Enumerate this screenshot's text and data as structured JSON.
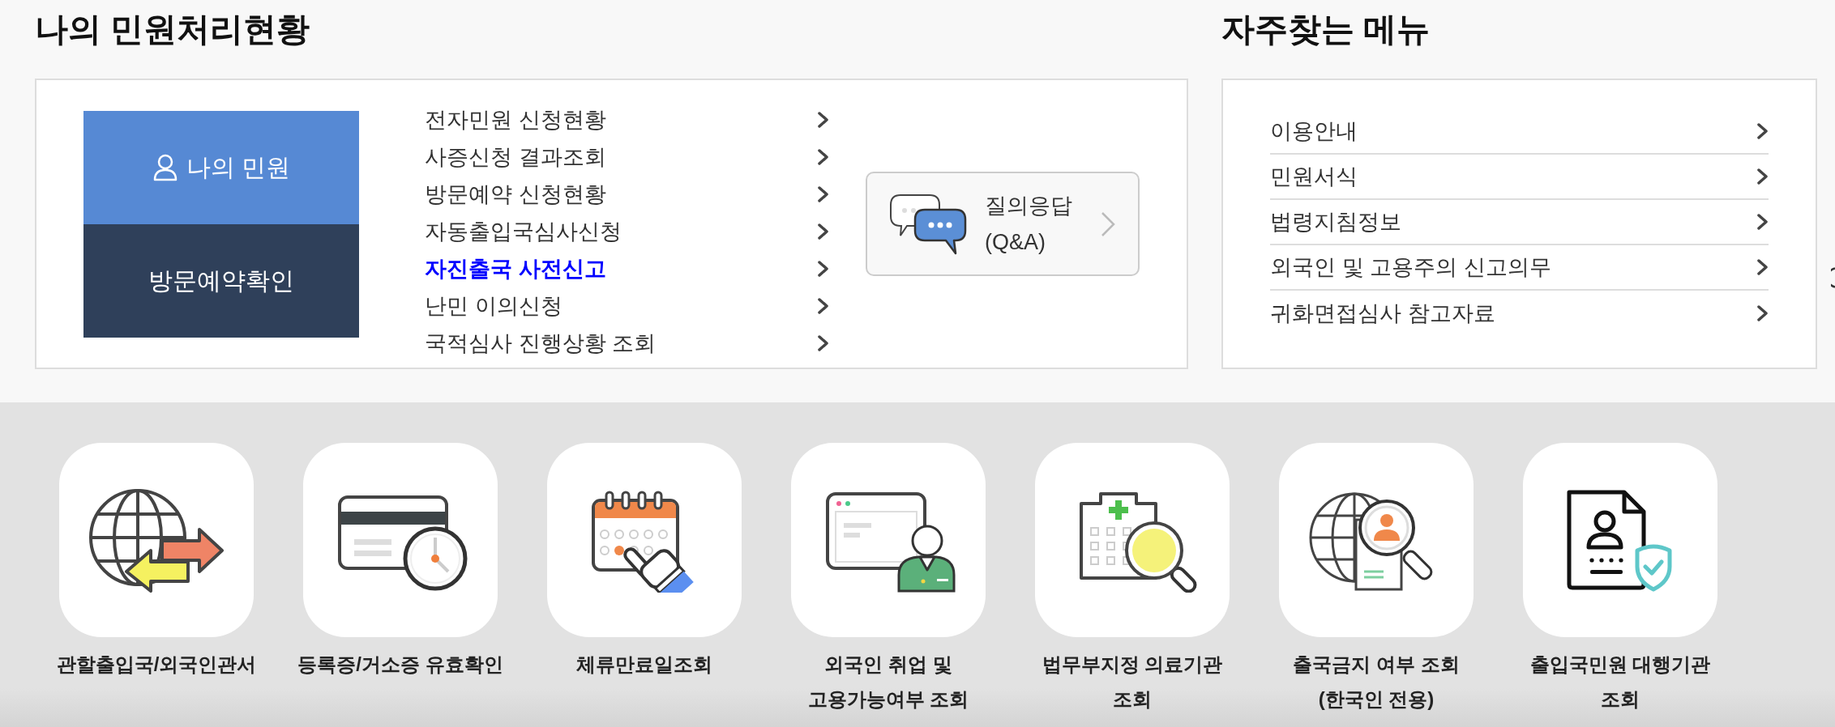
{
  "my_status": {
    "title": "나의 민원처리현황",
    "buttons": [
      {
        "kind": "primary",
        "label": "나의 민원"
      },
      {
        "kind": "secondary",
        "label": "방문예약확인"
      }
    ],
    "links": [
      {
        "label": "전자민원 신청현황",
        "selected": false
      },
      {
        "label": "사증신청 결과조회",
        "selected": false
      },
      {
        "label": "방문예약 신청현황",
        "selected": false
      },
      {
        "label": "자동출입국심사신청",
        "selected": false
      },
      {
        "label": "자진출국 사전신고",
        "selected": true
      },
      {
        "label": "난민 이의신청",
        "selected": false
      },
      {
        "label": "국적심사 진행상황 조회",
        "selected": false
      }
    ],
    "qna": {
      "lines": [
        "질의응답",
        "(Q&A)"
      ]
    }
  },
  "frequent_menu": {
    "title": "자주찾는 메뉴",
    "items": [
      "이용안내",
      "민원서식",
      "법령지침정보",
      "외국인 및 고용주의 신고의무",
      "귀화면접심사 참고자료"
    ]
  },
  "quick_services": [
    {
      "kind": "globe",
      "lines": [
        "관할출입국/외국인관서"
      ]
    },
    {
      "kind": "card",
      "lines": [
        "등록증/거소증 유효확인"
      ]
    },
    {
      "kind": "calendar",
      "lines": [
        "체류만료일조회"
      ]
    },
    {
      "kind": "screen",
      "lines": [
        "외국인 취업 및",
        "고용가능여부 조회"
      ]
    },
    {
      "kind": "clinic",
      "lines": [
        "법무부지정 의료기관",
        "조회"
      ]
    },
    {
      "kind": "search",
      "lines": [
        "출국금지 여부 조회",
        "(한국인 전용)"
      ]
    },
    {
      "kind": "shield",
      "lines": [
        "출입국민원 대행기관",
        "조회"
      ]
    }
  ]
}
